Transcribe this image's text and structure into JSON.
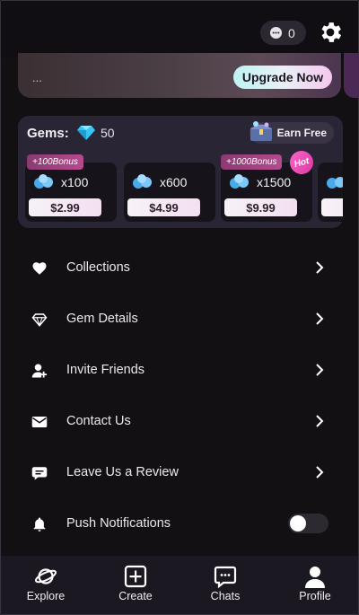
{
  "header": {
    "message_count": "0"
  },
  "upgrade": {
    "text": "...",
    "button_label": "Upgrade Now"
  },
  "gems": {
    "title": "Gems:",
    "balance": "50",
    "earn_free_label": "Earn Free",
    "hot_label": "Hot",
    "packs": [
      {
        "bonus": "+100Bonus",
        "quantity": "x100",
        "price": "$2.99"
      },
      {
        "bonus": "",
        "quantity": "x600",
        "price": "$4.99"
      },
      {
        "bonus": "+1000Bonus",
        "quantity": "x1500",
        "price": "$9.99"
      }
    ]
  },
  "menu": {
    "items": [
      {
        "label": "Collections",
        "icon": "heart-icon"
      },
      {
        "label": "Gem Details",
        "icon": "diamond-icon"
      },
      {
        "label": "Invite Friends",
        "icon": "add-user-icon"
      },
      {
        "label": "Contact Us",
        "icon": "mail-icon"
      },
      {
        "label": "Leave Us a Review",
        "icon": "review-icon"
      },
      {
        "label": "Push Notifications",
        "icon": "bell-icon"
      }
    ],
    "push_notifications_enabled": false
  },
  "tabs": [
    {
      "label": "Explore",
      "icon": "planet-icon"
    },
    {
      "label": "Create",
      "icon": "plus-square-icon"
    },
    {
      "label": "Chats",
      "icon": "chat-bubble-icon"
    },
    {
      "label": "Profile",
      "icon": "person-icon"
    }
  ],
  "colors": {
    "background": "#131014",
    "card": "#2a2535",
    "accent_pink": "#b54a8e",
    "gem_blue": "#37c6f4"
  }
}
